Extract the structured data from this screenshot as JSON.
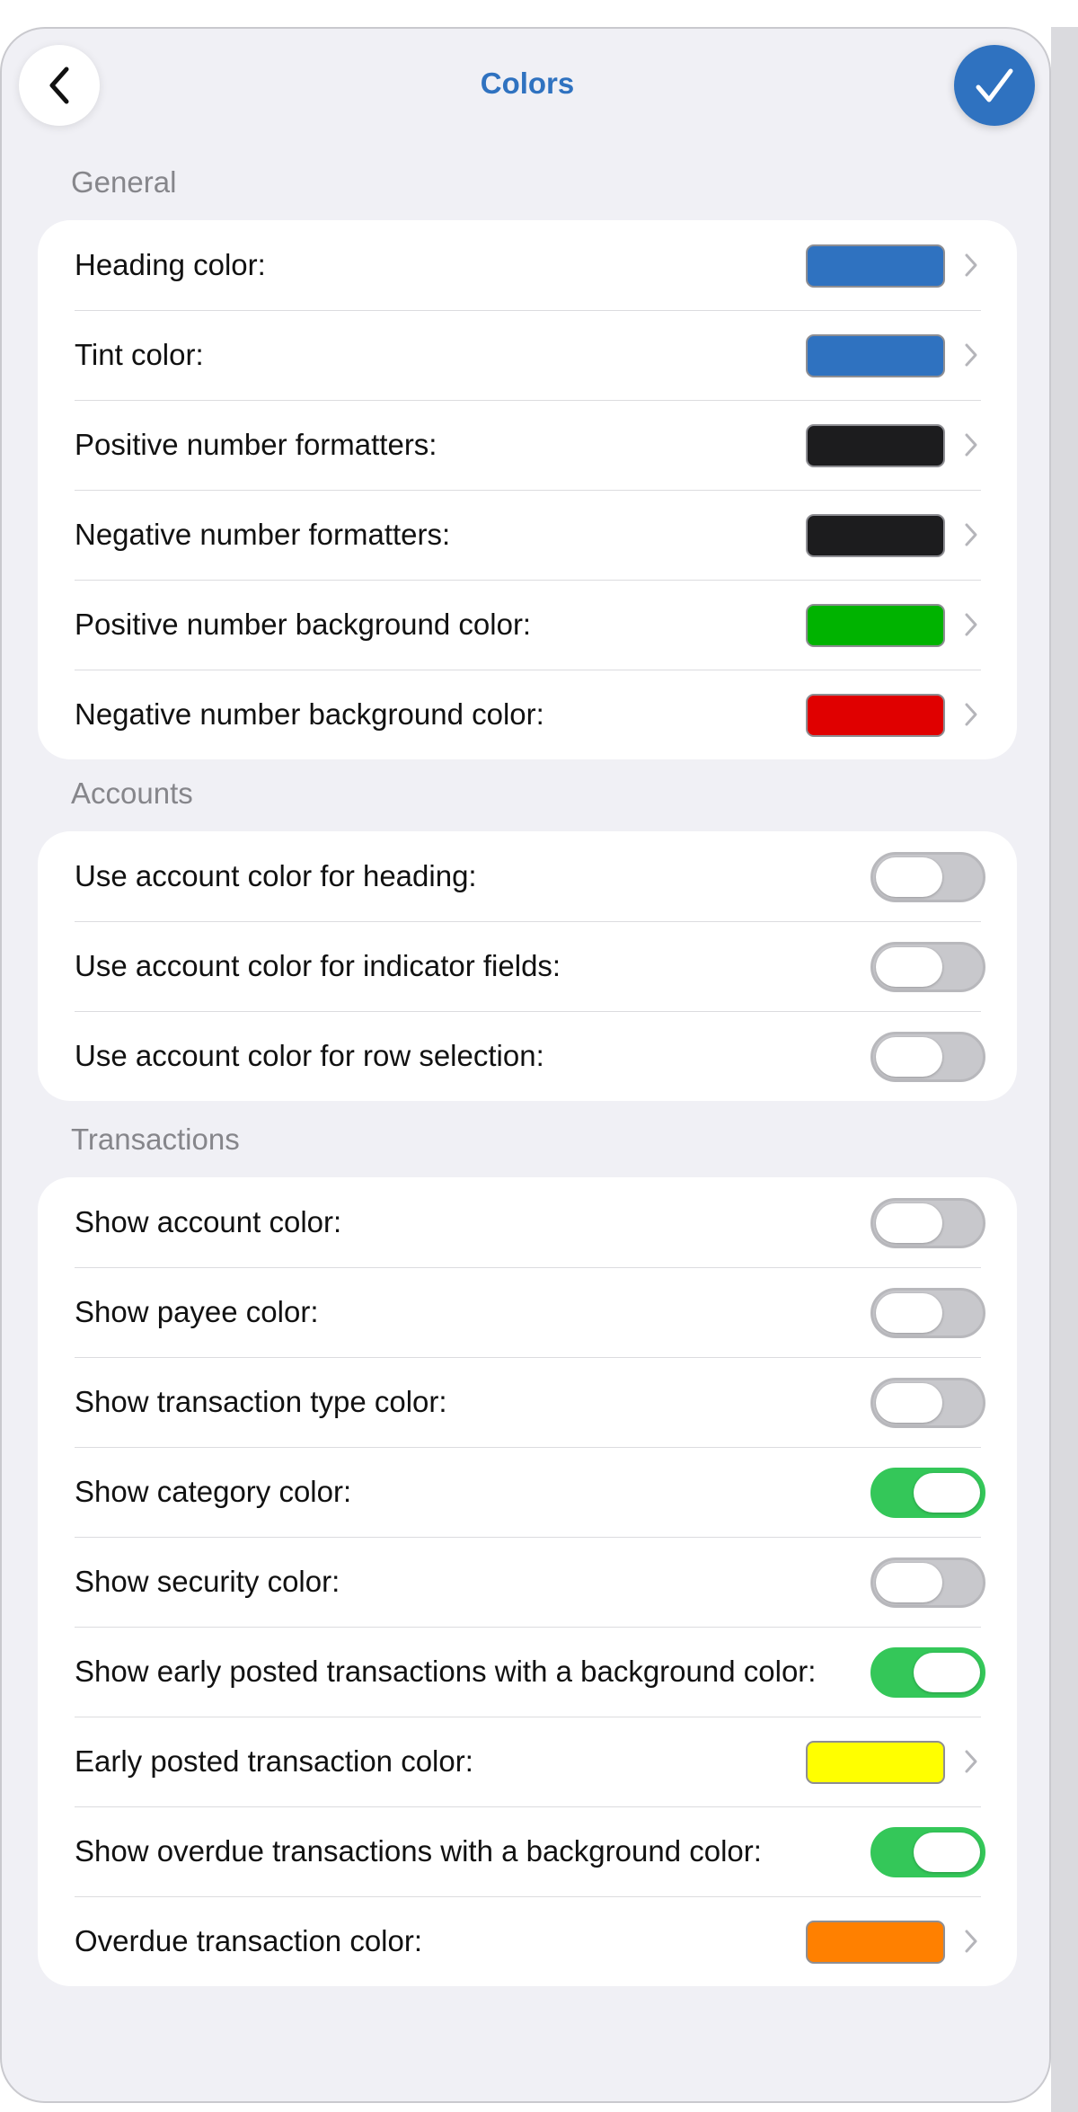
{
  "header": {
    "title": "Colors"
  },
  "sections": {
    "general": {
      "label": "General",
      "rows": [
        {
          "label": "Heading color:",
          "color": "#2f72c0"
        },
        {
          "label": "Tint color:",
          "color": "#2f72c0"
        },
        {
          "label": "Positive number formatters:",
          "color": "#1c1c1e"
        },
        {
          "label": "Negative number formatters:",
          "color": "#1c1c1e"
        },
        {
          "label": "Positive number background color:",
          "color": "#00b300"
        },
        {
          "label": "Negative number background color:",
          "color": "#e00000"
        }
      ]
    },
    "accounts": {
      "label": "Accounts",
      "rows": [
        {
          "label": "Use account color for heading:",
          "on": false
        },
        {
          "label": "Use account color for indicator fields:",
          "on": false
        },
        {
          "label": "Use account color for row selection:",
          "on": false
        }
      ]
    },
    "transactions": {
      "label": "Transactions",
      "rows": [
        {
          "label": "Show account color:",
          "on": false
        },
        {
          "label": "Show payee color:",
          "on": false
        },
        {
          "label": "Show transaction type color:",
          "on": false
        },
        {
          "label": "Show category color:",
          "on": true
        },
        {
          "label": "Show security color:",
          "on": false
        },
        {
          "label": "Show early posted transactions with a background color:",
          "on": true
        },
        {
          "label": "Early posted transaction color:",
          "color": "#ffff00"
        },
        {
          "label": "Show overdue transactions with a background color:",
          "on": true
        },
        {
          "label": "Overdue transaction color:",
          "color": "#ff8000"
        }
      ]
    }
  },
  "theme": {
    "accent": "#2f72c0",
    "switch_on": "#34c759"
  }
}
